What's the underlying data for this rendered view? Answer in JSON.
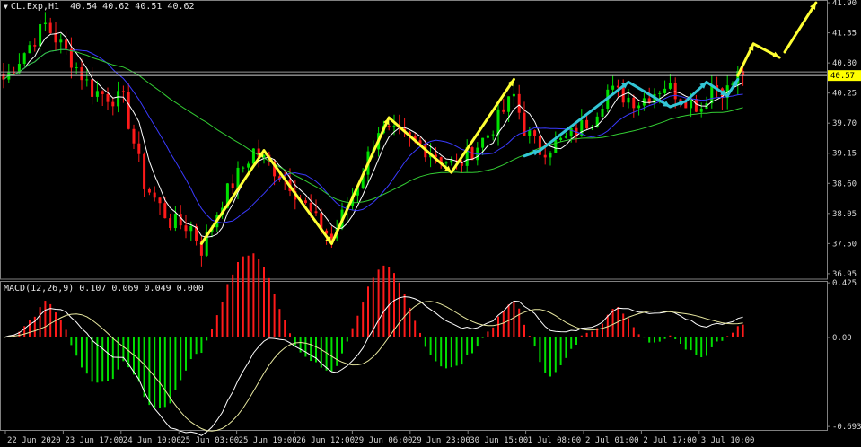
{
  "header": {
    "symbol": "CL.Exp,H1",
    "ohlc": "40.54 40.62 40.51 40.62"
  },
  "macd_header": "MACD(12,26,9) 0.107 0.069 0.049 0.000",
  "colors": {
    "background": "#000000",
    "bull": "#00e000",
    "bear": "#ff1a1a",
    "ma_fast": "#ffffff",
    "ma_slow": "#3a3aff",
    "ma_long": "#33cc33",
    "arrow_yellow": "#ffff33",
    "arrow_cyan": "#33c6d6",
    "current_price_tag": "#ffff00"
  },
  "chart_data": [
    {
      "type": "candlestick",
      "title": "CL.Exp,H1",
      "ylim": [
        36.85,
        41.95
      ],
      "y_ticks": [
        "41.90",
        "41.35",
        "40.80",
        "40.25",
        "39.70",
        "39.15",
        "38.60",
        "38.05",
        "37.50",
        "36.95"
      ],
      "y_tick_values": [
        41.9,
        41.35,
        40.8,
        40.25,
        39.7,
        39.15,
        38.6,
        38.05,
        37.5,
        36.95
      ],
      "current_price": "40.57",
      "x_tick_labels": [
        "22 Jun 2020",
        "23 Jun 17:00",
        "24 Jun 10:00",
        "25 Jun 03:00",
        "25 Jun 19:00",
        "26 Jun 12:00",
        "29 Jun 06:00",
        "29 Jun 23:00",
        "30 Jun 15:00",
        "1 Jul 08:00",
        "2 Jul 01:00",
        "2 Jul 17:00",
        "3 Jul 10:00"
      ],
      "price_path": [
        [
          0,
          40.5
        ],
        [
          8,
          41.5
        ],
        [
          12,
          41.0
        ],
        [
          17,
          40.3
        ],
        [
          20,
          40.2
        ],
        [
          23,
          40.1
        ],
        [
          27,
          38.6
        ],
        [
          32,
          37.9
        ],
        [
          36,
          37.8
        ],
        [
          38,
          37.4
        ],
        [
          42,
          38.3
        ],
        [
          48,
          39.2
        ],
        [
          55,
          38.6
        ],
        [
          60,
          37.9
        ],
        [
          63,
          37.6
        ],
        [
          68,
          38.6
        ],
        [
          72,
          39.6
        ],
        [
          80,
          39.3
        ],
        [
          87,
          38.9
        ],
        [
          93,
          39.5
        ],
        [
          98,
          40.2
        ],
        [
          100,
          39.6
        ],
        [
          103,
          39.2
        ],
        [
          108,
          39.4
        ],
        [
          113,
          39.8
        ],
        [
          116,
          40.3
        ],
        [
          122,
          40.1
        ],
        [
          127,
          40.4
        ],
        [
          130,
          40.2
        ],
        [
          134,
          40.0
        ],
        [
          136,
          40.4
        ],
        [
          139,
          40.3
        ],
        [
          141,
          40.57
        ]
      ],
      "overlays": [
        {
          "name": "fast-ma",
          "window": 5
        },
        {
          "name": "medium-ma",
          "window": 14
        },
        {
          "name": "slow-ma",
          "window": 40
        }
      ],
      "yellow_arrows": [
        {
          "from": [
            38,
            37.5
          ],
          "to": [
            50,
            39.2
          ]
        },
        {
          "from": [
            50,
            39.2
          ],
          "to": [
            63,
            37.5
          ]
        },
        {
          "from": [
            63,
            37.5
          ],
          "to": [
            74,
            39.8
          ]
        },
        {
          "from": [
            74,
            39.8
          ],
          "to": [
            86,
            38.8
          ]
        },
        {
          "from": [
            86,
            38.8
          ],
          "to": [
            98,
            40.5
          ]
        },
        {
          "from": [
            141,
            40.57
          ],
          "to": [
            144,
            41.15
          ]
        },
        {
          "from": [
            144,
            41.15
          ],
          "to": [
            149,
            40.9
          ]
        },
        {
          "from": [
            150,
            41.0
          ],
          "to": [
            156,
            41.9
          ]
        }
      ],
      "cyan_arrows": [
        {
          "from": [
            100,
            39.1
          ],
          "to": [
            103,
            39.2
          ]
        },
        {
          "from": [
            103,
            39.2
          ],
          "to": [
            120,
            40.45
          ]
        },
        {
          "from": [
            120,
            40.45
          ],
          "to": [
            128,
            40.0
          ]
        },
        {
          "from": [
            128,
            40.0
          ],
          "to": [
            131,
            40.1
          ]
        },
        {
          "from": [
            131,
            40.1
          ],
          "to": [
            135,
            40.45
          ]
        },
        {
          "from": [
            135,
            40.45
          ],
          "to": [
            139,
            40.2
          ]
        },
        {
          "from": [
            139,
            40.2
          ],
          "to": [
            141,
            40.5
          ]
        }
      ]
    },
    {
      "type": "macd",
      "title": "MACD(12,26,9) 0.107 0.069 0.049 0.000",
      "ylim": [
        -0.72,
        0.44
      ],
      "y_ticks": [
        "0.425",
        "0.00",
        "-0.693"
      ],
      "y_tick_values": [
        0.425,
        0.0,
        -0.693
      ],
      "values": {
        "main": 0.107,
        "signal": 0.069,
        "histogram": 0.049
      }
    }
  ]
}
